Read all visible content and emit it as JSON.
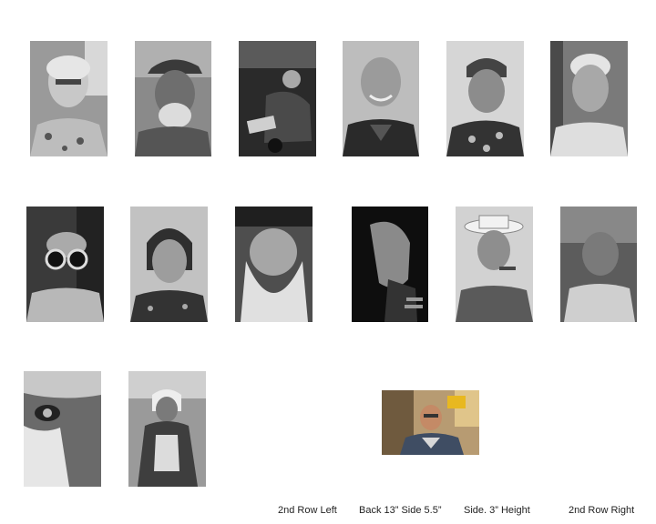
{
  "photos": [
    {
      "subject": "elderly woman with glasses, floral blouse",
      "tone": "bw"
    },
    {
      "subject": "bearded man in cap",
      "tone": "bw"
    },
    {
      "subject": "man seated on street",
      "tone": "bw"
    },
    {
      "subject": "smiling shaved-head man in robe",
      "tone": "bw"
    },
    {
      "subject": "elderly woman with headscarf",
      "tone": "bw"
    },
    {
      "subject": "white-haired man",
      "tone": "bw"
    },
    {
      "subject": "man wearing round goggles",
      "tone": "bw"
    },
    {
      "subject": "woman with short hair",
      "tone": "bw"
    },
    {
      "subject": "bearded man in bandana",
      "tone": "bw"
    },
    {
      "subject": "elderly woman in profile",
      "tone": "bw"
    },
    {
      "subject": "man in hat with cigar",
      "tone": "bw"
    },
    {
      "subject": "elderly man in tank top",
      "tone": "bw"
    },
    {
      "subject": "close-up of old man's eye with knit cap",
      "tone": "bw"
    },
    {
      "subject": "seated elderly woman in headscarf",
      "tone": "bw"
    },
    {
      "subject": "smiling man with glasses",
      "tone": "color"
    }
  ],
  "captions": {
    "left": "2nd Row Left",
    "back": "Back 13” Side 5.5”",
    "side": "Side.  3” Height",
    "right": "2nd Row Right"
  }
}
